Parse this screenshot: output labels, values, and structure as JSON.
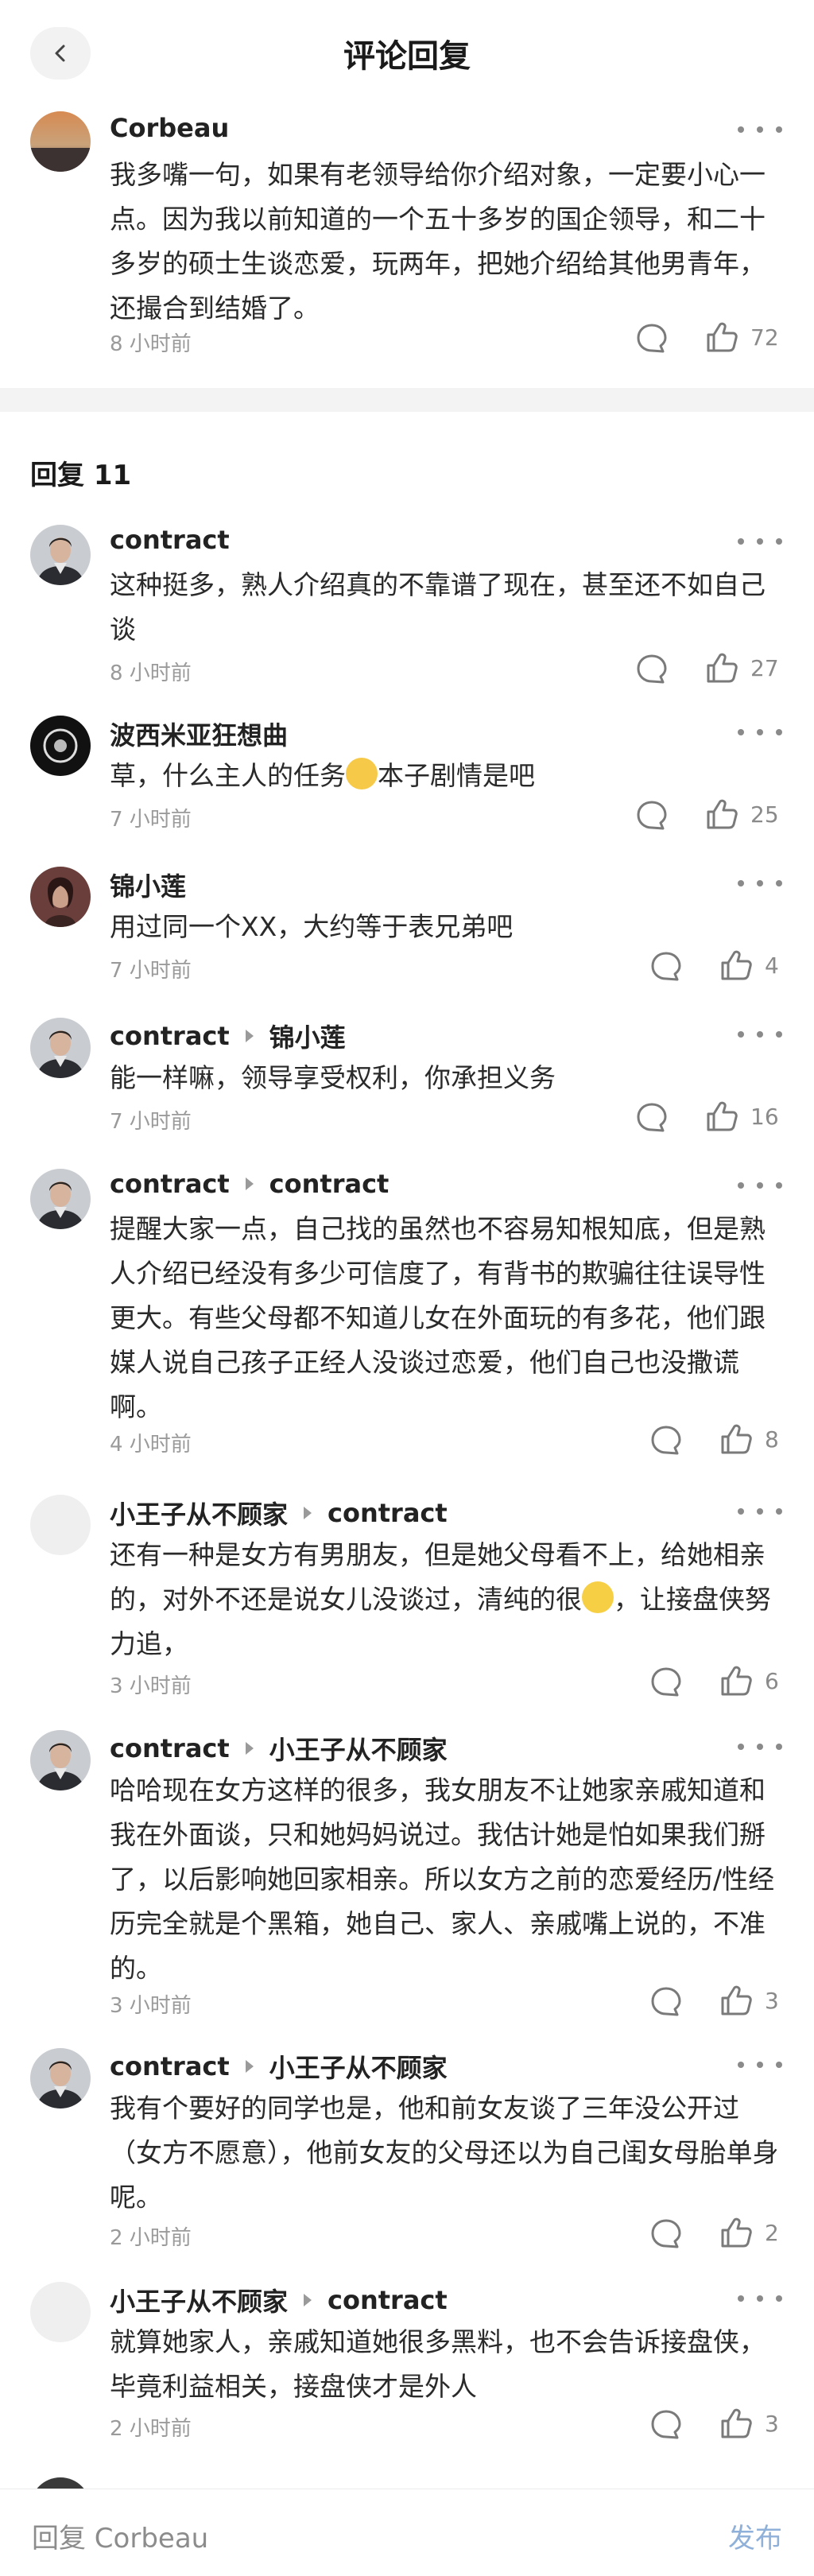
{
  "header": {
    "title": "评论回复"
  },
  "parent_comment": {
    "author": "Corbeau",
    "text": "我多嘴一句，如果有老领导给你介绍对象，一定要小心一点。因为我以前知道的一个五十多岁的国企领导，和二十多岁的硕士生谈恋爱，玩两年，把她介绍给其他男青年，还撮合到结婚了。",
    "time": "8 小时前",
    "likes": "72"
  },
  "replies_header": "回复 11",
  "replies": [
    {
      "author": "contract",
      "reply_to": "",
      "text": "这种挺多，熟人介绍真的不靠谱了现在，甚至还不如自己谈",
      "time": "8 小时前",
      "likes": "27"
    },
    {
      "author": "波西米亚狂想曲",
      "reply_to": "",
      "text_before": "草，什么主人的任务",
      "text_after": "本子剧情是吧",
      "time": "7 小时前",
      "likes": "25"
    },
    {
      "author": "锦小莲",
      "reply_to": "",
      "text": "用过同一个XX，大约等于表兄弟吧",
      "time": "7 小时前",
      "likes": "4"
    },
    {
      "author": "contract",
      "reply_to": "锦小莲",
      "text": "能一样嘛，领导享受权利，你承担义务",
      "time": "7 小时前",
      "likes": "16"
    },
    {
      "author": "contract",
      "reply_to": "contract",
      "text": "提醒大家一点，自己找的虽然也不容易知根知底，但是熟人介绍已经没有多少可信度了，有背书的欺骗往往误导性更大。有些父母都不知道儿女在外面玩的有多花，他们跟媒人说自己孩子正经人没谈过恋爱，他们自己也没撒谎啊。",
      "time": "4 小时前",
      "likes": "8"
    },
    {
      "author": "小王子从不顾家",
      "reply_to": "contract",
      "text_before": "还有一种是女方有男朋友，但是她父母看不上，给她相亲的，对外不还是说女儿没谈过，清纯的很",
      "text_after": "，让接盘侠努力追，",
      "time": "3 小时前",
      "likes": "6"
    },
    {
      "author": "contract",
      "reply_to": "小王子从不顾家",
      "text": "哈哈现在女方这样的很多，我女朋友不让她家亲戚知道和我在外面谈，只和她妈妈说过。我估计她是怕如果我们掰了，以后影响她回家相亲。所以女方之前的恋爱经历/性经历完全就是个黑箱，她自己、家人、亲戚嘴上说的，不准的。",
      "time": "3 小时前",
      "likes": "3"
    },
    {
      "author": "contract",
      "reply_to": "小王子从不顾家",
      "text": "我有个要好的同学也是，他和前女友谈了三年没公开过（女方不愿意），他前女友的父母还以为自己闺女母胎单身呢。",
      "time": "2 小时前",
      "likes": "2"
    },
    {
      "author": "小王子从不顾家",
      "reply_to": "contract",
      "text": "就算她家人，亲戚知道她很多黑料，也不会告诉接盘侠，毕竟利益相关，接盘侠才是外人",
      "time": "2 小时前",
      "likes": "3"
    }
  ],
  "bottom_bar": {
    "placeholder": "回复 Corbeau",
    "publish": "发布"
  },
  "icons": {
    "back": "chevron-left-icon",
    "reply": "speech-bubble-icon",
    "like": "thumbs-up-icon",
    "more": "more-dots-icon"
  },
  "colors": {
    "publish": "#8fb0d8",
    "muted": "#9a9a9a",
    "divider": "#f3f3f3"
  }
}
